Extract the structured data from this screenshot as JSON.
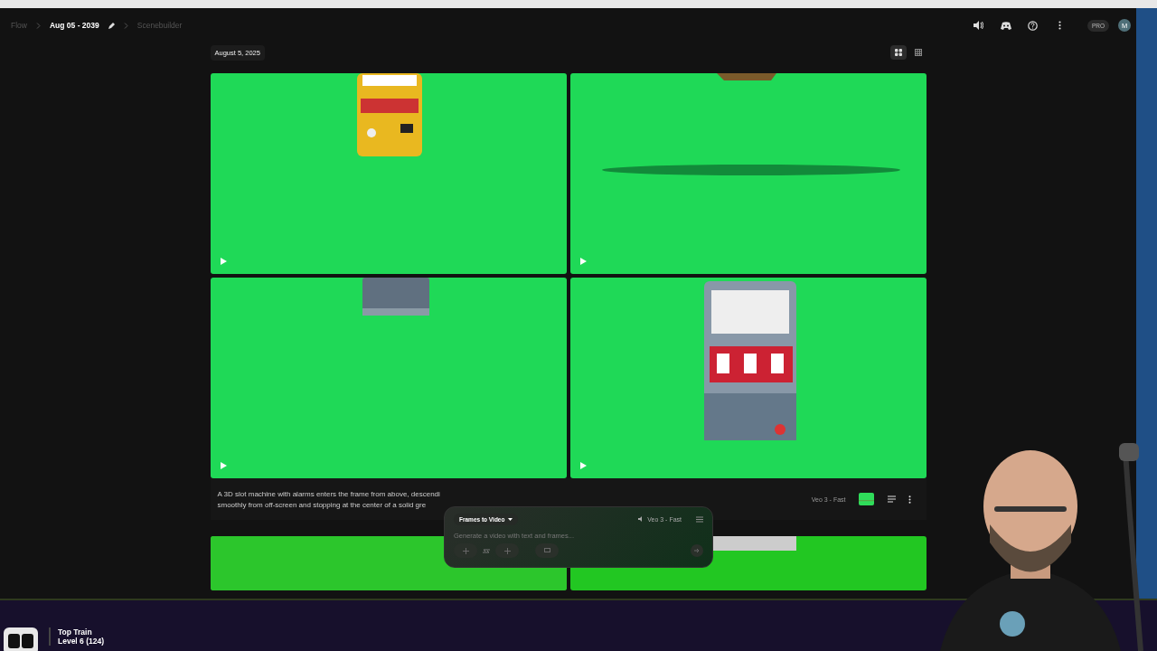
{
  "breadcrumb": [
    {
      "label": "Flow",
      "selected": false
    },
    {
      "label": "Aug 05 - 2039",
      "selected": true
    },
    {
      "label": "Scenebuilder",
      "selected": false
    }
  ],
  "header": {
    "badge": "PRO",
    "avatar": "M"
  },
  "date": "August 5, 2025",
  "view_toggle": [
    {
      "kind": "grid",
      "selected": true
    },
    {
      "kind": "table",
      "selected": false
    }
  ],
  "prompt": {
    "lines": [
      "A 3D slot machine with alarms enters the frame from above, descendi",
      "smoothly from off-screen and stopping at the center of a solid gre"
    ],
    "model": "Veo 3 - Fast"
  },
  "composer": {
    "mode": "Frames to Video",
    "model": "Veo 3 - Fast",
    "placeholder": "Generate a video with text and frames..."
  },
  "overlay": {
    "title": "Top Train",
    "subtitle": "Level 6  (124)"
  }
}
